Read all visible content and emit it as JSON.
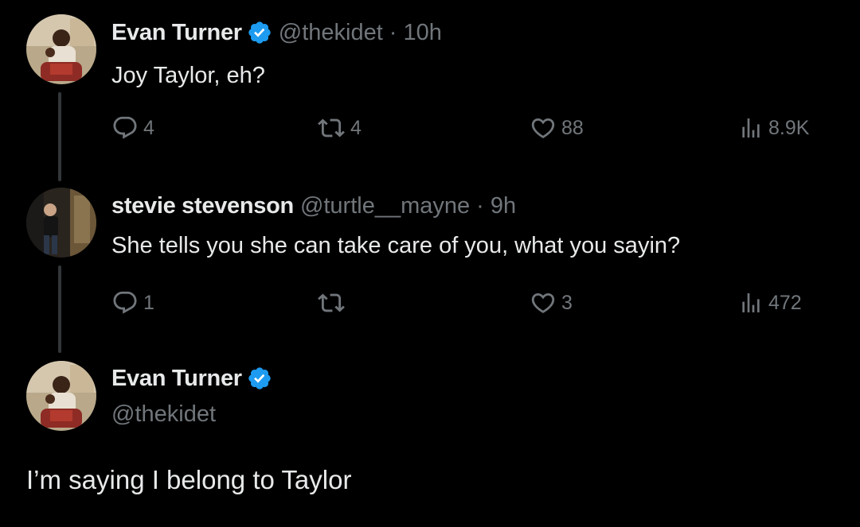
{
  "tweets": [
    {
      "name": "Evan Turner",
      "handle": "@thekidet",
      "dot": "·",
      "time": "10h",
      "text": "Joy Taylor, eh?",
      "replies": "4",
      "reposts": "4",
      "likes": "88",
      "views": "8.9K"
    },
    {
      "name": "stevie stevenson",
      "handle": "@turtle__mayne",
      "dot": "·",
      "time": "9h",
      "text": "She tells you she can take care of you, what you sayin?",
      "replies": "1",
      "reposts": "",
      "likes": "3",
      "views": "472"
    }
  ],
  "main_tweet": {
    "name": "Evan Turner",
    "handle": "@thekidet",
    "text": "I’m saying I belong to Taylor"
  },
  "colors": {
    "background": "#000000",
    "primary_text": "#e7e9ea",
    "secondary_text": "#71767b",
    "verified_blue": "#1d9bf0",
    "thread_line": "#333639"
  },
  "icons": [
    "reply-icon",
    "repost-icon",
    "like-icon",
    "views-icon",
    "verified-badge-icon"
  ]
}
